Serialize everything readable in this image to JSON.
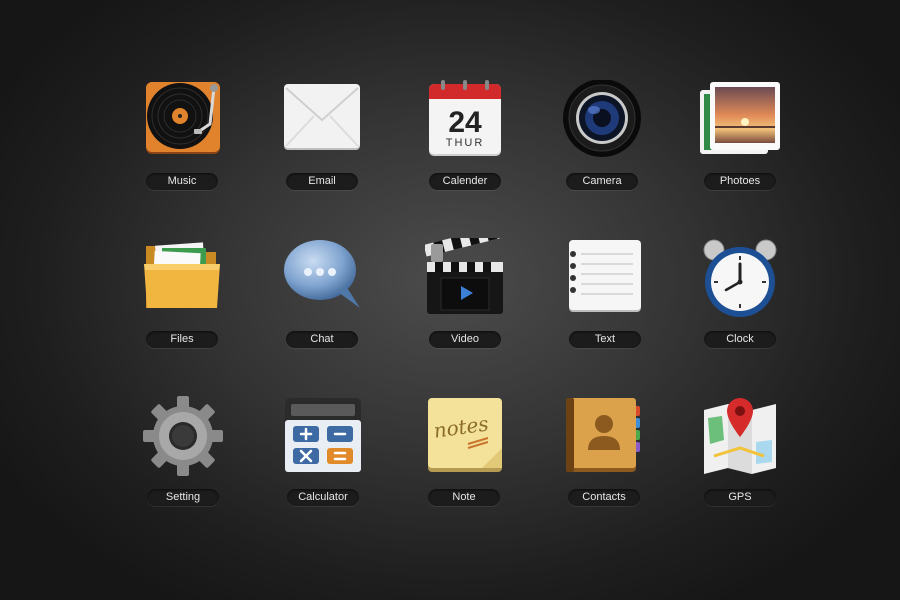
{
  "apps": [
    {
      "label": "Music",
      "icon": "music-icon"
    },
    {
      "label": "Email",
      "icon": "email-icon"
    },
    {
      "label": "Calender",
      "icon": "calendar-icon",
      "date": "24",
      "day": "THUR"
    },
    {
      "label": "Camera",
      "icon": "camera-icon"
    },
    {
      "label": "Photoes",
      "icon": "photos-icon"
    },
    {
      "label": "Files",
      "icon": "folder-icon"
    },
    {
      "label": "Chat",
      "icon": "chat-bubble-icon"
    },
    {
      "label": "Video",
      "icon": "clapperboard-icon"
    },
    {
      "label": "Text",
      "icon": "notepad-icon"
    },
    {
      "label": "Clock",
      "icon": "alarm-clock-icon"
    },
    {
      "label": "Setting",
      "icon": "gear-icon"
    },
    {
      "label": "Calculator",
      "icon": "calculator-icon"
    },
    {
      "label": "Note",
      "icon": "sticky-note-icon",
      "note_text": "notes"
    },
    {
      "label": "Contacts",
      "icon": "address-book-icon"
    },
    {
      "label": "GPS",
      "icon": "map-pin-icon"
    }
  ]
}
